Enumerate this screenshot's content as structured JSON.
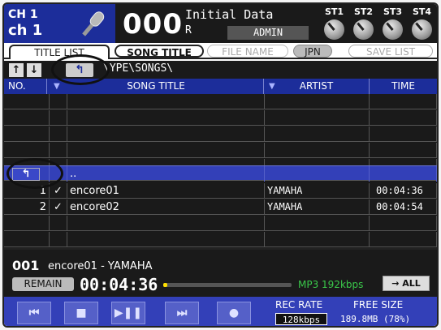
{
  "header": {
    "channel_line1": "CH 1",
    "channel_line2": "ch 1",
    "mic_icon": "microphone-icon",
    "scene_number": "000",
    "scene_name": "Initial Data",
    "scene_sub": "R",
    "user_level": "ADMIN",
    "st_labels": [
      "ST1",
      "ST2",
      "ST3",
      "ST4"
    ]
  },
  "tabs": {
    "title_list": "TITLE LIST",
    "song_title": "SONG TITLE",
    "file_name": "FILE NAME",
    "jpn": "JPN",
    "save_list": "SAVE LIST"
  },
  "path_bar": {
    "up_arrow": "↑",
    "down_arrow": "↓",
    "parent_button": "↰",
    "path": "\\YPE\\SONGS\\"
  },
  "columns": {
    "no": "NO.",
    "song_title": "SONG TITLE",
    "artist": "ARTIST",
    "time": "TIME"
  },
  "list": {
    "parent_row_label": "..",
    "parent_button": "↰",
    "rows": [
      {
        "no": "1",
        "check": "✓",
        "title": "encore01",
        "artist": "YAMAHA",
        "time": "00:04:36"
      },
      {
        "no": "2",
        "check": "✓",
        "title": "encore02",
        "artist": "YAMAHA",
        "time": "00:04:54"
      }
    ]
  },
  "now_playing": {
    "number": "001",
    "song": "encore01 - YAMAHA",
    "remain_label": "REMAIN",
    "remain_time": "00:04:36",
    "progress_fraction": 0.03,
    "format": "MP3  192kbps",
    "repeat_mode": "→ ALL"
  },
  "transport": {
    "prev": "⏮",
    "stop": "■",
    "play_pause": "▶❚❚",
    "next": "⏭",
    "record": "●",
    "rec_rate_label": "REC RATE",
    "rec_rate_value": "128kbps",
    "free_size_label": "FREE SIZE",
    "free_size_value": "189.8MB (78%)"
  },
  "colors": {
    "accent_blue": "#1c2d9a",
    "row_highlight": "#3340b8",
    "format_green": "#3ac84a",
    "progress_yellow": "#ffe000"
  }
}
